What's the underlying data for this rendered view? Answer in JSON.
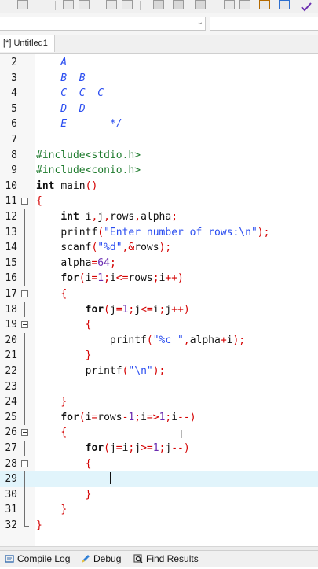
{
  "toolbar": {
    "icons": [
      "compile-icon",
      "open-icon",
      "save-icon",
      "print-icon",
      "undo-icon",
      "redo-icon",
      "check-icon"
    ]
  },
  "editor_tab": {
    "label": "[*] Untitled1"
  },
  "code_lines": [
    {
      "n": "2",
      "html": "<span class='cm'>    A</span>"
    },
    {
      "n": "3",
      "html": "<span class='cm'>    B  B</span>"
    },
    {
      "n": "4",
      "html": "<span class='cm'>    C  C  C</span>"
    },
    {
      "n": "5",
      "html": "<span class='cm'>    D  D</span>"
    },
    {
      "n": "6",
      "html": "<span class='cm'>    E       */</span>"
    },
    {
      "n": "7",
      "html": ""
    },
    {
      "n": "8",
      "html": "<span class='pp'>#include&lt;stdio.h&gt;</span>"
    },
    {
      "n": "9",
      "html": "<span class='pp'>#include&lt;conio.h&gt;</span>"
    },
    {
      "n": "10",
      "html": "<span class='kw'>int</span> <span class='id'>main</span><span class='pn'>()</span>"
    },
    {
      "n": "11",
      "html": "<span class='pn'>{</span>"
    },
    {
      "n": "12",
      "html": "    <span class='kw'>int</span> <span class='id'>i</span><span class='pn'>,</span><span class='id'>j</span><span class='pn'>,</span><span class='id'>rows</span><span class='pn'>,</span><span class='id'>alpha</span><span class='pn'>;</span>"
    },
    {
      "n": "13",
      "html": "    <span class='id'>printf</span><span class='pn'>(</span><span class='str'>\"Enter number of rows:\\n\"</span><span class='pn'>);</span>"
    },
    {
      "n": "14",
      "html": "    <span class='id'>scanf</span><span class='pn'>(</span><span class='str'>\"%d\"</span><span class='pn'>,&amp;</span><span class='id'>rows</span><span class='pn'>);</span>"
    },
    {
      "n": "15",
      "html": "    <span class='id'>alpha</span><span class='op'>=</span><span class='num'>64</span><span class='pn'>;</span>"
    },
    {
      "n": "16",
      "html": "    <span class='kw'>for</span><span class='pn'>(</span><span class='id'>i</span><span class='op'>=</span><span class='num'>1</span><span class='pn'>;</span><span class='id'>i</span><span class='op'>&lt;=</span><span class='id'>rows</span><span class='pn'>;</span><span class='id'>i</span><span class='op'>++</span><span class='pn'>)</span>"
    },
    {
      "n": "17",
      "html": "    <span class='pn'>{</span>"
    },
    {
      "n": "18",
      "html": "        <span class='kw'>for</span><span class='pn'>(</span><span class='id'>j</span><span class='op'>=</span><span class='num'>1</span><span class='pn'>;</span><span class='id'>j</span><span class='op'>&lt;=</span><span class='id'>i</span><span class='pn'>;</span><span class='id'>j</span><span class='op'>++</span><span class='pn'>)</span>"
    },
    {
      "n": "19",
      "html": "        <span class='pn'>{</span>"
    },
    {
      "n": "20",
      "html": "            <span class='id'>printf</span><span class='pn'>(</span><span class='str'>\"%c \"</span><span class='pn'>,</span><span class='id'>alpha</span><span class='op'>+</span><span class='id'>i</span><span class='pn'>);</span>"
    },
    {
      "n": "21",
      "html": "        <span class='pn'>}</span>"
    },
    {
      "n": "22",
      "html": "        <span class='id'>printf</span><span class='pn'>(</span><span class='str'>\"\\n\"</span><span class='pn'>);</span>"
    },
    {
      "n": "23",
      "html": ""
    },
    {
      "n": "24",
      "html": "    <span class='pn'>}</span>"
    },
    {
      "n": "25",
      "html": "    <span class='kw'>for</span><span class='pn'>(</span><span class='id'>i</span><span class='op'>=</span><span class='id'>rows</span><span class='op'>-</span><span class='num'>1</span><span class='pn'>;</span><span class='id'>i</span><span class='op'>=&gt;</span><span class='num'>1</span><span class='pn'>;</span><span class='id'>i</span><span class='op'>--</span><span class='pn'>)</span>"
    },
    {
      "n": "26",
      "html": "    <span class='pn'>{</span>"
    },
    {
      "n": "27",
      "html": "        <span class='kw'>for</span><span class='pn'>(</span><span class='id'>j</span><span class='op'>=</span><span class='id'>i</span><span class='pn'>;</span><span class='id'>j</span><span class='op'>&gt;=</span><span class='num'>1</span><span class='pn'>;</span><span class='id'>j</span><span class='op'>--</span><span class='pn'>)</span>"
    },
    {
      "n": "28",
      "html": "        <span class='pn'>{</span>"
    },
    {
      "n": "29",
      "html": "            <span class='caret'></span>"
    },
    {
      "n": "30",
      "html": "        <span class='pn'>}</span>"
    },
    {
      "n": "31",
      "html": "    <span class='pn'>}</span>"
    },
    {
      "n": "32",
      "html": "<span class='pn'>}</span>"
    }
  ],
  "folds": [
    "11",
    "17",
    "19",
    "26",
    "28"
  ],
  "current_line": "29",
  "bottom_tabs": [
    {
      "label": "Compile Log",
      "icon": "compile-log-icon"
    },
    {
      "label": "Debug",
      "icon": "debug-icon"
    },
    {
      "label": "Find Results",
      "icon": "find-results-icon"
    }
  ],
  "colors": {
    "comment": "#2a4df0",
    "preprocessor": "#1f7b2e",
    "operator": "#d40000",
    "number": "#6a2bb0",
    "current_line_bg": "#e1f4fb"
  }
}
